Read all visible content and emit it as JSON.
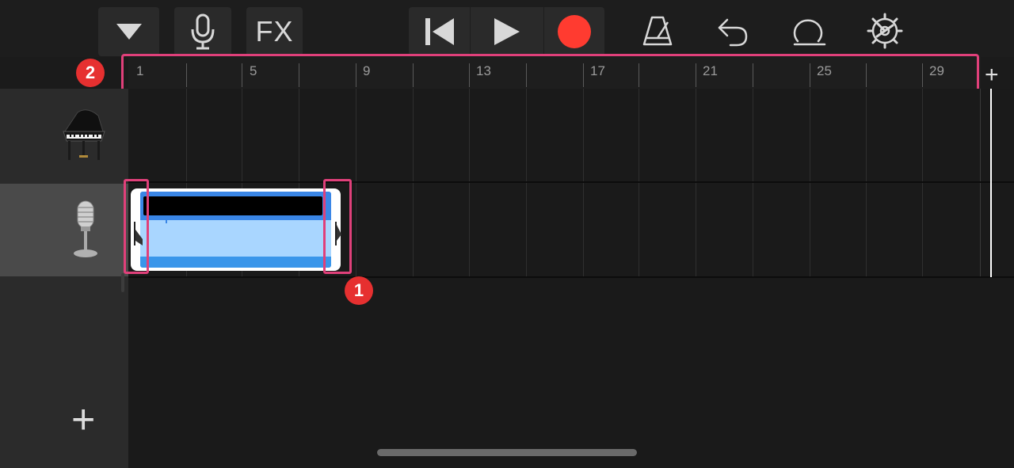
{
  "toolbar": {
    "view_menu_icon": "triangle-down",
    "mic_icon": "microphone",
    "fx_label": "FX",
    "rewind_icon": "go-to-start",
    "play_icon": "play",
    "record_icon": "record",
    "metronome_icon": "metronome",
    "undo_icon": "undo",
    "loop_icon": "loop",
    "settings_icon": "gear"
  },
  "ruler": {
    "bars": [
      "1",
      "5",
      "9",
      "13",
      "17",
      "21",
      "25",
      "29"
    ],
    "add_section_label": "+"
  },
  "annotations": {
    "badge_1": "1",
    "badge_2": "2"
  },
  "tracks": [
    {
      "name": "piano-track",
      "icon": "grand-piano"
    },
    {
      "name": "audio-recorder-track",
      "icon": "microphone"
    }
  ],
  "add_track_label": "+",
  "colors": {
    "record": "#ff3b30",
    "annotation": "#e0407a",
    "badge": "#e63030",
    "region": "#a9d6ff",
    "region_header": "#3a86e6"
  }
}
